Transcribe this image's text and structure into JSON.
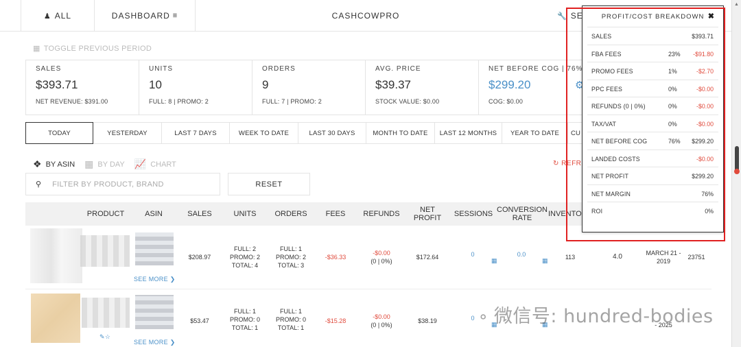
{
  "nav": {
    "all": "ALL",
    "dashboard": "DASHBOARD",
    "brand": "CASHCOWPRO",
    "settings_partial": "SE"
  },
  "toggle_previous": "TOGGLE PREVIOUS PERIOD",
  "kpis": [
    {
      "label": "SALES",
      "value": "$393.71",
      "sub": "NET REVENUE: $391.00"
    },
    {
      "label": "UNITS",
      "value": "10",
      "sub": "FULL: 8 | PROMO: 2"
    },
    {
      "label": "ORDERS",
      "value": "9",
      "sub": "FULL: 7 | PROMO: 2"
    },
    {
      "label": "AVG. PRICE",
      "value": "$39.37",
      "sub": "STOCK VALUE: $0.00"
    },
    {
      "label": "NET BEFORE COG | 76%",
      "value": "$299.20",
      "sub": "COG: $0.00"
    }
  ],
  "periods": [
    "TODAY",
    "YESTERDAY",
    "LAST 7 DAYS",
    "WEEK TO DATE",
    "LAST 30 DAYS",
    "MONTH TO DATE",
    "LAST 12 MONTHS",
    "YEAR TO DATE",
    "CU"
  ],
  "views": {
    "by_asin": "BY ASIN",
    "by_day": "BY DAY",
    "chart": "CHART",
    "refresh": "REFR"
  },
  "filter": {
    "placeholder": "FILTER BY PRODUCT, BRAND",
    "reset": "RESET"
  },
  "table": {
    "headers": {
      "product": "PRODUCT",
      "asin": "ASIN",
      "sales": "SALES",
      "units": "UNITS",
      "orders": "ORDERS",
      "fees": "FEES",
      "refunds": "REFUNDS",
      "net_profit_1": "NET",
      "net_profit_2": "PROFIT",
      "sessions": "SESSIONS",
      "conversion_1": "CONVERSION",
      "conversion_2": "RATE",
      "inventory": "INVENTO"
    },
    "rows": [
      {
        "see_more": "SEE MORE",
        "sales": "$208.97",
        "units": [
          "FULL: 2",
          "PROMO: 2",
          "TOTAL: 4"
        ],
        "orders": [
          "FULL: 1",
          "PROMO: 2",
          "TOTAL: 3"
        ],
        "fees": "-$36.33",
        "refunds": [
          "-$0.00",
          "(0 | 0%)"
        ],
        "net_profit": "$172.64",
        "sessions": "0",
        "conversion": "0.0",
        "inventory": "113",
        "rating": "4.0",
        "date": [
          "MARCH 21 -",
          "2019"
        ],
        "rank": "23751"
      },
      {
        "see_more": "SEE MORE",
        "sales": "$53.47",
        "units": [
          "FULL: 1",
          "PROMO: 0",
          "TOTAL: 1"
        ],
        "orders": [
          "FULL: 1",
          "PROMO: 0",
          "TOTAL: 1"
        ],
        "fees": "-$15.28",
        "refunds": [
          "-$0.00",
          "(0 | 0%)"
        ],
        "net_profit": "$38.19",
        "sessions": "0",
        "date_tail": "- 2025"
      }
    ]
  },
  "popup": {
    "title": "PROFIT/COST BREAKDOWN",
    "rows": [
      {
        "label": "SALES",
        "pct": "",
        "value": "$393.71",
        "negative": false
      },
      {
        "label": "FBA FEES",
        "pct": "23%",
        "value": "-$91.80",
        "negative": true
      },
      {
        "label": "PROMO FEES",
        "pct": "1%",
        "value": "-$2.70",
        "negative": true
      },
      {
        "label": "PPC FEES",
        "pct": "0%",
        "value": "-$0.00",
        "negative": true
      },
      {
        "label": "REFUNDS (0 | 0%)",
        "pct": "0%",
        "value": "-$0.00",
        "negative": true
      },
      {
        "label": "TAX/VAT",
        "pct": "0%",
        "value": "-$0.00",
        "negative": true
      },
      {
        "label": "NET BEFORE COG",
        "pct": "76%",
        "value": "$299.20",
        "negative": false
      },
      {
        "label": "LANDED COSTS",
        "pct": "",
        "value": "-$0.00",
        "negative": true
      },
      {
        "label": "NET PROFIT",
        "pct": "",
        "value": "$299.20",
        "negative": false
      },
      {
        "label": "NET MARGIN",
        "pct": "",
        "value": "76%",
        "negative": false
      },
      {
        "label": "ROI",
        "pct": "",
        "value": "0%",
        "negative": false
      }
    ]
  },
  "watermark": "微信号: hundred-bodies",
  "colors": {
    "accent_blue": "#4a90c8",
    "negative_red": "#e04a3c",
    "highlight_box": "#e02020"
  }
}
